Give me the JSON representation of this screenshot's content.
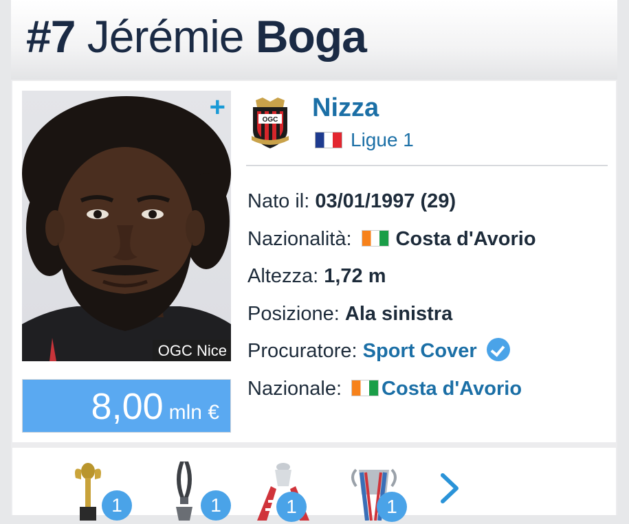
{
  "header": {
    "number": "#7",
    "first_name": "Jérémie",
    "last_name": "Boga"
  },
  "photo": {
    "caption": "OGC Nice",
    "plus_icon": "+"
  },
  "market_value": {
    "amount": "8,00",
    "unit": "mln €"
  },
  "club": {
    "name": "Nizza",
    "league": "Ligue 1",
    "league_flag": "france-flag"
  },
  "facts": {
    "born": {
      "label": "Nato il:",
      "value": "03/01/1997 (29)"
    },
    "nationality": {
      "label": "Nazionalità:",
      "value": "Costa d'Avorio"
    },
    "height": {
      "label": "Altezza:",
      "value": "1,72 m"
    },
    "position": {
      "label": "Posizione:",
      "value": "Ala sinistra"
    },
    "agent": {
      "label": "Procuratore:",
      "value": "Sport Cover"
    },
    "national_team": {
      "label": "Nazionale:",
      "value": "Costa d'Avorio"
    }
  },
  "trophies": [
    {
      "icon": "africa-cup-trophy-icon",
      "count": "1"
    },
    {
      "icon": "silver-cup-trophy-icon",
      "count": "1"
    },
    {
      "icon": "fa-cup-trophy-icon",
      "count": "1"
    },
    {
      "icon": "league-cup-trophy-icon",
      "count": "1"
    }
  ],
  "colors": {
    "accent": "#1b6fa6",
    "value_box": "#5aa9f1",
    "badge": "#4aa3e8",
    "title": "#1a2a44"
  }
}
